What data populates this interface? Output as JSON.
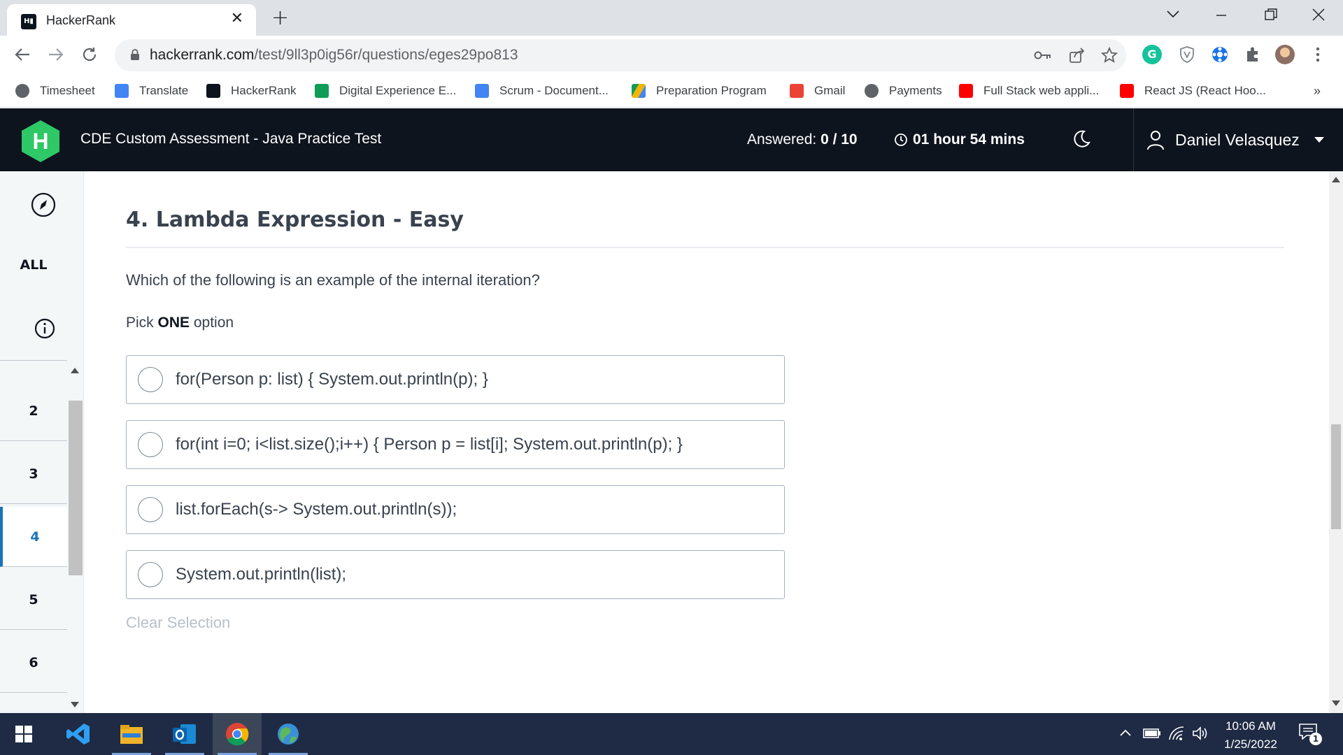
{
  "browser": {
    "tab_title": "HackerRank",
    "tab_favicon_text": "H",
    "url_host": "hackerrank.com",
    "url_path": "/test/9ll3p0ig56r/questions/eges29po813",
    "bookmarks": [
      {
        "label": "Timesheet",
        "icon": "globe-icon",
        "color": "#5f6368"
      },
      {
        "label": "Translate",
        "icon": "translate-icon",
        "color": "#4285f4"
      },
      {
        "label": "HackerRank",
        "icon": "hackerrank-icon",
        "color": "#0e141e"
      },
      {
        "label": "Digital Experience E...",
        "icon": "sheets-plus-icon",
        "color": "#0f9d58"
      },
      {
        "label": "Scrum - Document...",
        "icon": "docs-icon",
        "color": "#4285f4"
      },
      {
        "label": "Preparation Program",
        "icon": "drive-icon",
        "color": "#f4b400"
      },
      {
        "label": "Gmail",
        "icon": "gmail-icon",
        "color": "#ea4335"
      },
      {
        "label": "Payments",
        "icon": "globe-icon",
        "color": "#5f6368"
      },
      {
        "label": "Full Stack web appli...",
        "icon": "youtube-icon",
        "color": "#ff0000"
      },
      {
        "label": "React JS (React Hoo...",
        "icon": "youtube-icon",
        "color": "#ff0000"
      }
    ],
    "bookmarks_overflow": "»"
  },
  "header": {
    "logo_letter": "H",
    "test_title": "CDE Custom Assessment - Java Practice Test",
    "answered_label": "Answered: ",
    "answered_value": "0 / 10",
    "timer": "01 hour 54 mins",
    "user_name": "Daniel Velasquez"
  },
  "rail": {
    "all_label": "ALL",
    "questions": [
      "2",
      "3",
      "4",
      "5",
      "6"
    ],
    "active_question": "4"
  },
  "question": {
    "title": "4. Lambda Expression - Easy",
    "text": "Which of the following is an example of the internal iteration?",
    "pick_prefix": "Pick ",
    "pick_bold": "ONE",
    "pick_suffix": " option",
    "options": [
      "for(Person p: list) { System.out.println(p); }",
      "for(int i=0; i<list.size();i++) { Person p = list[i]; System.out.println(p); }",
      "list.forEach(s-> System.out.println(s));",
      "System.out.println(list);"
    ],
    "clear_selection": "Clear Selection"
  },
  "taskbar": {
    "time": "10:06 AM",
    "date": "1/25/2022",
    "notification_count": "1"
  },
  "colors": {
    "hr_dark": "#0e141e",
    "hr_green": "#2ec866",
    "active_blue": "#1874b9",
    "taskbar": "#1f2b44"
  }
}
